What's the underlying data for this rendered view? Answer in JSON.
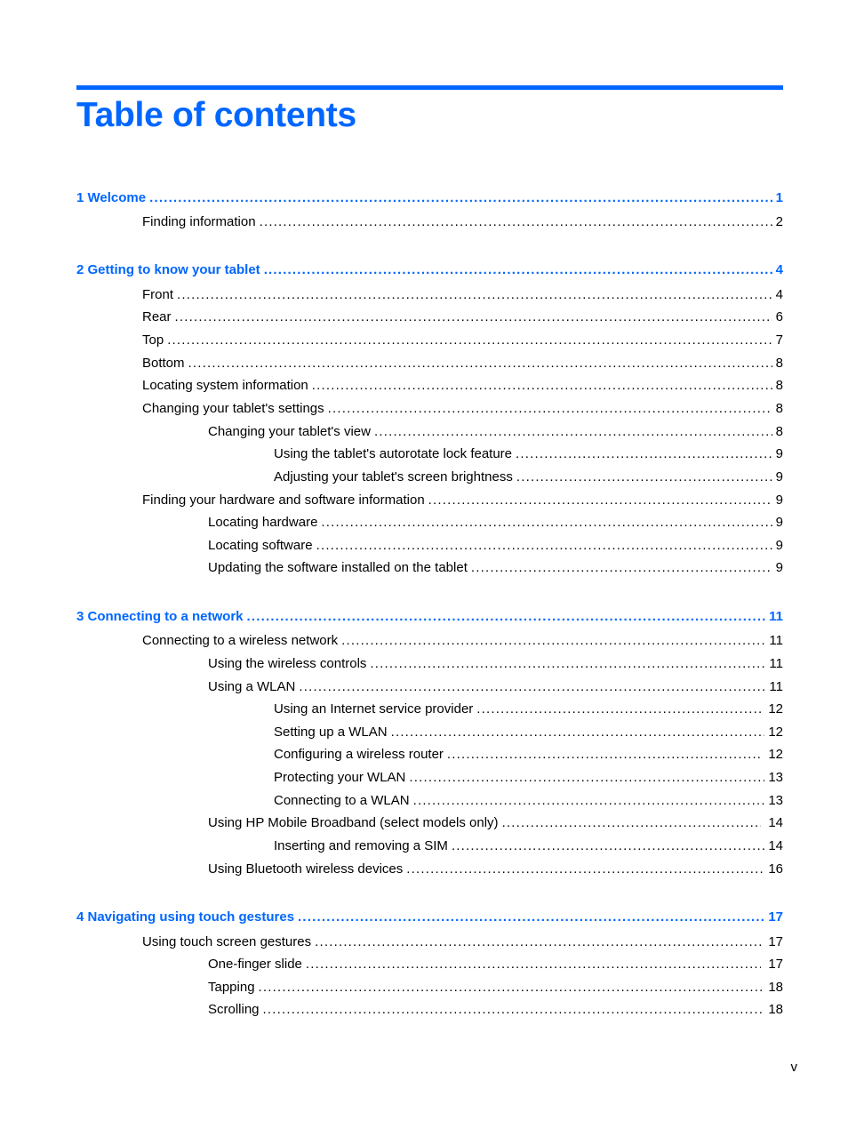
{
  "document": {
    "title": "Table of contents",
    "page_folio": "v",
    "accent_color": "#0066ff"
  },
  "toc": [
    {
      "level": 1,
      "number": "1",
      "label": "1  Welcome",
      "page": "1"
    },
    {
      "level": 2,
      "label": "Finding information",
      "page": "2"
    },
    {
      "level": 1,
      "number": "2",
      "label": "2  Getting to know your tablet",
      "page": "4"
    },
    {
      "level": 2,
      "label": "Front",
      "page": "4"
    },
    {
      "level": 2,
      "label": "Rear",
      "page": "6"
    },
    {
      "level": 2,
      "label": "Top",
      "page": "7"
    },
    {
      "level": 2,
      "label": "Bottom",
      "page": "8"
    },
    {
      "level": 2,
      "label": "Locating system information",
      "page": "8"
    },
    {
      "level": 2,
      "label": "Changing your tablet's settings",
      "page": "8"
    },
    {
      "level": 3,
      "label": "Changing your tablet's view",
      "page": "8"
    },
    {
      "level": 4,
      "label": "Using the tablet's autorotate lock feature",
      "page": "9"
    },
    {
      "level": 4,
      "label": "Adjusting your tablet's screen brightness",
      "page": "9"
    },
    {
      "level": 2,
      "label": "Finding your hardware and software information",
      "page": "9"
    },
    {
      "level": 3,
      "label": "Locating hardware",
      "page": "9"
    },
    {
      "level": 3,
      "label": "Locating software",
      "page": "9"
    },
    {
      "level": 3,
      "label": "Updating the software installed on the tablet",
      "page": "9"
    },
    {
      "level": 1,
      "number": "3",
      "label": "3  Connecting to a network",
      "page": "11"
    },
    {
      "level": 2,
      "label": "Connecting to a wireless network",
      "page": "11"
    },
    {
      "level": 3,
      "label": "Using the wireless controls",
      "page": "11"
    },
    {
      "level": 3,
      "label": "Using a WLAN",
      "page": "11"
    },
    {
      "level": 4,
      "label": "Using an Internet service provider",
      "page": "12"
    },
    {
      "level": 4,
      "label": "Setting up a WLAN",
      "page": "12"
    },
    {
      "level": 4,
      "label": "Configuring a wireless router",
      "page": "12"
    },
    {
      "level": 4,
      "label": "Protecting your WLAN",
      "page": "13"
    },
    {
      "level": 4,
      "label": "Connecting to a WLAN",
      "page": "13"
    },
    {
      "level": 3,
      "label": "Using HP Mobile Broadband (select models only)",
      "page": "14"
    },
    {
      "level": 4,
      "label": "Inserting and removing a SIM",
      "page": "14"
    },
    {
      "level": 3,
      "label": "Using Bluetooth wireless devices",
      "page": "16"
    },
    {
      "level": 1,
      "number": "4",
      "label": "4  Navigating using touch gestures",
      "page": "17"
    },
    {
      "level": 2,
      "label": "Using touch screen gestures",
      "page": "17"
    },
    {
      "level": 3,
      "label": "One-finger slide",
      "page": "17"
    },
    {
      "level": 3,
      "label": "Tapping",
      "page": "18"
    },
    {
      "level": 3,
      "label": "Scrolling",
      "page": "18"
    }
  ]
}
